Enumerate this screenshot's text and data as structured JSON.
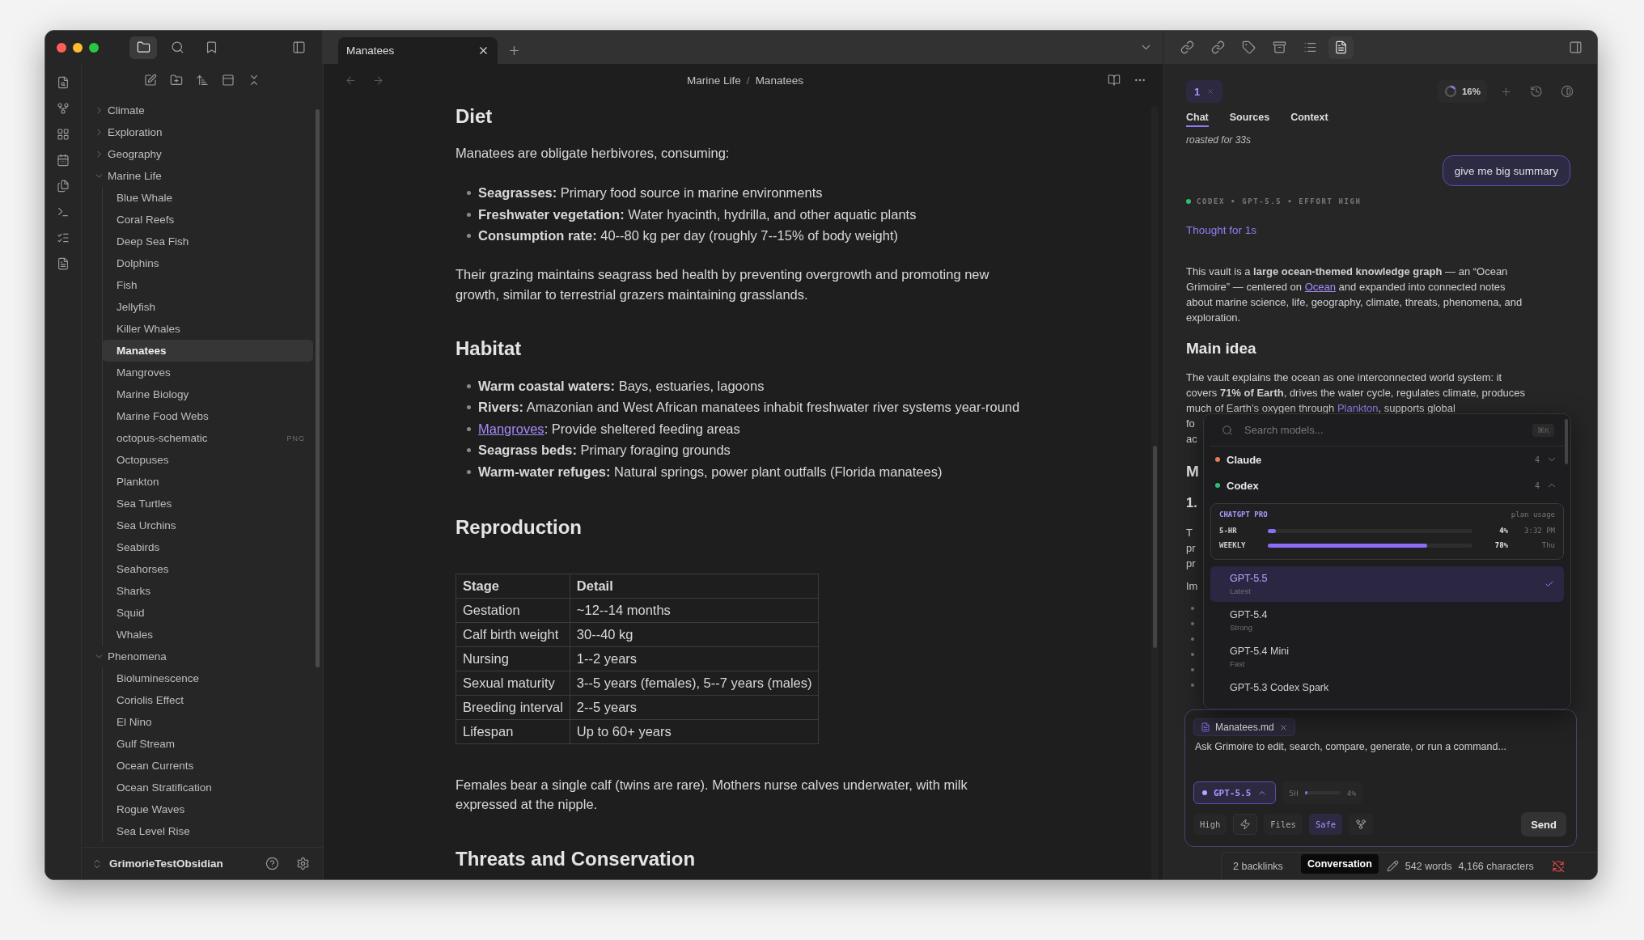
{
  "window": {
    "sidebar_tabs": [
      {
        "kind": "files",
        "selected": true
      },
      {
        "kind": "search",
        "selected": false
      },
      {
        "kind": "bookmarks",
        "selected": false
      }
    ],
    "tabs": [
      {
        "label": "Manatees",
        "selected": true
      }
    ],
    "right_tools": [
      {
        "kind": "backlinks",
        "selected": false
      },
      {
        "kind": "outgoing",
        "selected": false
      },
      {
        "kind": "tags",
        "selected": false
      },
      {
        "kind": "archive",
        "selected": false
      },
      {
        "kind": "outline",
        "selected": false
      },
      {
        "kind": "assistant",
        "selected": true
      }
    ]
  },
  "file_tree": [
    {
      "kind": "folder",
      "label": "Climate",
      "expanded": false
    },
    {
      "kind": "folder",
      "label": "Exploration",
      "expanded": false
    },
    {
      "kind": "folder",
      "label": "Geography",
      "expanded": false
    },
    {
      "kind": "folder",
      "label": "Marine Life",
      "expanded": true,
      "children": [
        {
          "kind": "file",
          "label": "Blue Whale",
          "selected": false
        },
        {
          "kind": "file",
          "label": "Coral Reefs",
          "selected": false
        },
        {
          "kind": "file",
          "label": "Deep Sea Fish",
          "selected": false
        },
        {
          "kind": "file",
          "label": "Dolphins",
          "selected": false
        },
        {
          "kind": "file",
          "label": "Fish",
          "selected": false
        },
        {
          "kind": "file",
          "label": "Jellyfish",
          "selected": false
        },
        {
          "kind": "file",
          "label": "Killer Whales",
          "selected": false
        },
        {
          "kind": "file",
          "label": "Manatees",
          "selected": true
        },
        {
          "kind": "file",
          "label": "Mangroves",
          "selected": false
        },
        {
          "kind": "file",
          "label": "Marine Biology",
          "selected": false
        },
        {
          "kind": "file",
          "label": "Marine Food Webs",
          "selected": false
        },
        {
          "kind": "file",
          "label": "octopus-schematic",
          "selected": false,
          "badge": "PNG"
        },
        {
          "kind": "file",
          "label": "Octopuses",
          "selected": false
        },
        {
          "kind": "file",
          "label": "Plankton",
          "selected": false
        },
        {
          "kind": "file",
          "label": "Sea Turtles",
          "selected": false
        },
        {
          "kind": "file",
          "label": "Sea Urchins",
          "selected": false
        },
        {
          "kind": "file",
          "label": "Seabirds",
          "selected": false
        },
        {
          "kind": "file",
          "label": "Seahorses",
          "selected": false
        },
        {
          "kind": "file",
          "label": "Sharks",
          "selected": false
        },
        {
          "kind": "file",
          "label": "Squid",
          "selected": false
        },
        {
          "kind": "file",
          "label": "Whales",
          "selected": false
        }
      ]
    },
    {
      "kind": "folder",
      "label": "Phenomena",
      "expanded": true,
      "children": [
        {
          "kind": "file",
          "label": "Bioluminescence",
          "selected": false
        },
        {
          "kind": "file",
          "label": "Coriolis Effect",
          "selected": false
        },
        {
          "kind": "file",
          "label": "El Nino",
          "selected": false
        },
        {
          "kind": "file",
          "label": "Gulf Stream",
          "selected": false
        },
        {
          "kind": "file",
          "label": "Ocean Currents",
          "selected": false
        },
        {
          "kind": "file",
          "label": "Ocean Stratification",
          "selected": false
        },
        {
          "kind": "file",
          "label": "Rogue Waves",
          "selected": false
        },
        {
          "kind": "file",
          "label": "Sea Level Rise",
          "selected": false
        }
      ]
    }
  ],
  "vault": {
    "name": "GrimorieTestObsidian"
  },
  "breadcrumb": {
    "parts": [
      "Marine Life",
      "Manatees"
    ],
    "separator": "/"
  },
  "note": [
    {
      "kind": "heading",
      "text": "Diet"
    },
    {
      "kind": "paragraph",
      "text": "Manatees are obligate herbivores, consuming:"
    },
    {
      "kind": "bullets",
      "items": [
        {
          "term": "Seagrasses:",
          "text": " Primary food source in marine environments",
          "link": false
        },
        {
          "term": "Freshwater vegetation:",
          "text": " Water hyacinth, hydrilla, and other aquatic plants",
          "link": false
        },
        {
          "term": "Consumption rate:",
          "text": " 40--80 kg per day (roughly 7--15% of body weight)",
          "link": false
        }
      ]
    },
    {
      "kind": "paragraph",
      "text": "Their grazing maintains seagrass bed health by preventing overgrowth and promoting new growth, similar to terrestrial grazers maintaining grasslands."
    },
    {
      "kind": "heading",
      "text": "Habitat"
    },
    {
      "kind": "bullets",
      "items": [
        {
          "term": "Warm coastal waters:",
          "text": " Bays, estuaries, lagoons",
          "link": false
        },
        {
          "term": "Rivers:",
          "text": " Amazonian and West African manatees inhabit freshwater river systems year-round",
          "link": false
        },
        {
          "term": "Mangroves",
          "text": ": Provide sheltered feeding areas",
          "link": true
        },
        {
          "term": "Seagrass beds:",
          "text": " Primary foraging grounds",
          "link": false
        },
        {
          "term": "Warm-water refuges:",
          "text": " Natural springs, power plant outfalls (Florida manatees)",
          "link": false
        }
      ]
    },
    {
      "kind": "heading",
      "text": "Reproduction"
    },
    {
      "kind": "table",
      "columns": [
        "Stage",
        "Detail"
      ],
      "rows": [
        [
          "Gestation",
          "~12--14 months"
        ],
        [
          "Calf birth weight",
          "30--40 kg"
        ],
        [
          "Nursing",
          "1--2 years"
        ],
        [
          "Sexual maturity",
          "3--5 years (females), 5--7 years (males)"
        ],
        [
          "Breeding interval",
          "2--5 years"
        ],
        [
          "Lifespan",
          "Up to 60+ years"
        ]
      ]
    },
    {
      "kind": "paragraph",
      "text": "Females bear a single calf (twins are rare). Mothers nurse calves underwater, with milk expressed at the nipple."
    },
    {
      "kind": "heading",
      "text": "Threats and Conservation"
    }
  ],
  "assistant": {
    "session_tabs": [
      {
        "label": "1",
        "selected": true
      }
    ],
    "context": {
      "level": 0.16,
      "reading": "16%"
    },
    "panel_tabs": [
      {
        "label": "Chat",
        "selected": true
      },
      {
        "label": "Sources",
        "selected": false
      },
      {
        "label": "Context",
        "selected": false
      }
    ],
    "messages": [
      {
        "kind": "cut",
        "text": "roasted for 33s"
      },
      {
        "kind": "user",
        "text": "give me big summary"
      },
      {
        "kind": "meta",
        "text": "CODEX • GPT-5.5 • EFFORT HIGH",
        "color": "#2fbf71"
      },
      {
        "kind": "thought",
        "text": "Thought for 1s"
      },
      {
        "kind": "rich",
        "segments": [
          {
            "kind": "text",
            "text": "This vault is a "
          },
          {
            "kind": "bold",
            "text": "large ocean-themed knowledge graph"
          },
          {
            "kind": "text",
            "text": " — an “Ocean Grimoire” — centered on "
          },
          {
            "kind": "link",
            "text": "Ocean"
          },
          {
            "kind": "text",
            "text": " and expanded into connected notes about marine science, life, geography, climate, threats, phenomena, and exploration."
          }
        ]
      },
      {
        "kind": "heading",
        "text": "Main idea"
      },
      {
        "kind": "rich",
        "segments": [
          {
            "kind": "text",
            "text": "The vault explains the ocean as one interconnected world system: it covers "
          },
          {
            "kind": "bold",
            "text": "71% of Earth"
          },
          {
            "kind": "text",
            "text": ", drives the water cycle, regulates climate, produces much of Earth’s oxygen through "
          },
          {
            "kind": "plain_link",
            "text": "Plankton"
          },
          {
            "kind": "text",
            "text": ", supports global"
          }
        ]
      },
      {
        "kind": "line",
        "text": "fo"
      },
      {
        "kind": "line",
        "text": "ac"
      },
      {
        "kind": "heading_part",
        "text": "M"
      },
      {
        "kind": "subheading_part",
        "text": "1."
      },
      {
        "kind": "line_gap",
        "text": "T"
      },
      {
        "kind": "line",
        "text": "pr"
      },
      {
        "kind": "line",
        "text": "pr"
      },
      {
        "kind": "line_gap",
        "text": "Im"
      },
      {
        "kind": "bullet"
      },
      {
        "kind": "bullet"
      },
      {
        "kind": "bullet"
      },
      {
        "kind": "bullet"
      },
      {
        "kind": "bullet"
      },
      {
        "kind": "bullet"
      }
    ],
    "model_picker": {
      "placeholder": "Search models...",
      "shortcut": "⌘K",
      "providers": [
        {
          "name": "Claude",
          "count": "4",
          "color": "#e8795a",
          "expanded": false
        },
        {
          "name": "Codex",
          "count": "4",
          "color": "#2fbf71",
          "expanded": true
        }
      ],
      "usage": {
        "plan": "CHATGPT PRO",
        "caption": "plan usage",
        "meters": [
          {
            "label": "5-HR",
            "level": 0.04,
            "percent": "4%",
            "reset": "3:32 PM"
          },
          {
            "label": "WEEKLY",
            "level": 0.78,
            "percent": "78%",
            "reset": "Thu"
          }
        ]
      },
      "models": [
        {
          "name": "GPT-5.5",
          "note": "Latest",
          "selected": true
        },
        {
          "name": "GPT-5.4",
          "note": "Strong",
          "selected": false
        },
        {
          "name": "GPT-5.4 Mini",
          "note": "Fast",
          "selected": false
        },
        {
          "name": "GPT-5.3 Codex Spark",
          "selected": false
        }
      ]
    },
    "composer": {
      "attachment": "Manatees.md",
      "placeholder": "Ask Grimoire to edit, search, compare, generate, or run a command...",
      "model": "GPT-5.5",
      "usage": {
        "label": "5H",
        "level": 0.04,
        "percent": "4%"
      },
      "options": [
        {
          "kind": "text",
          "label": "High",
          "on": false
        },
        {
          "kind": "bolt",
          "on": false
        },
        {
          "kind": "text",
          "label": "Files",
          "on": false
        },
        {
          "kind": "text",
          "label": "Safe",
          "on": true
        },
        {
          "kind": "fork",
          "on": false
        }
      ],
      "send": "Send"
    }
  },
  "status_bar": {
    "backlinks": "2 backlinks",
    "tooltip": "Conversation",
    "words": "542 words",
    "characters": "4,166 characters"
  }
}
